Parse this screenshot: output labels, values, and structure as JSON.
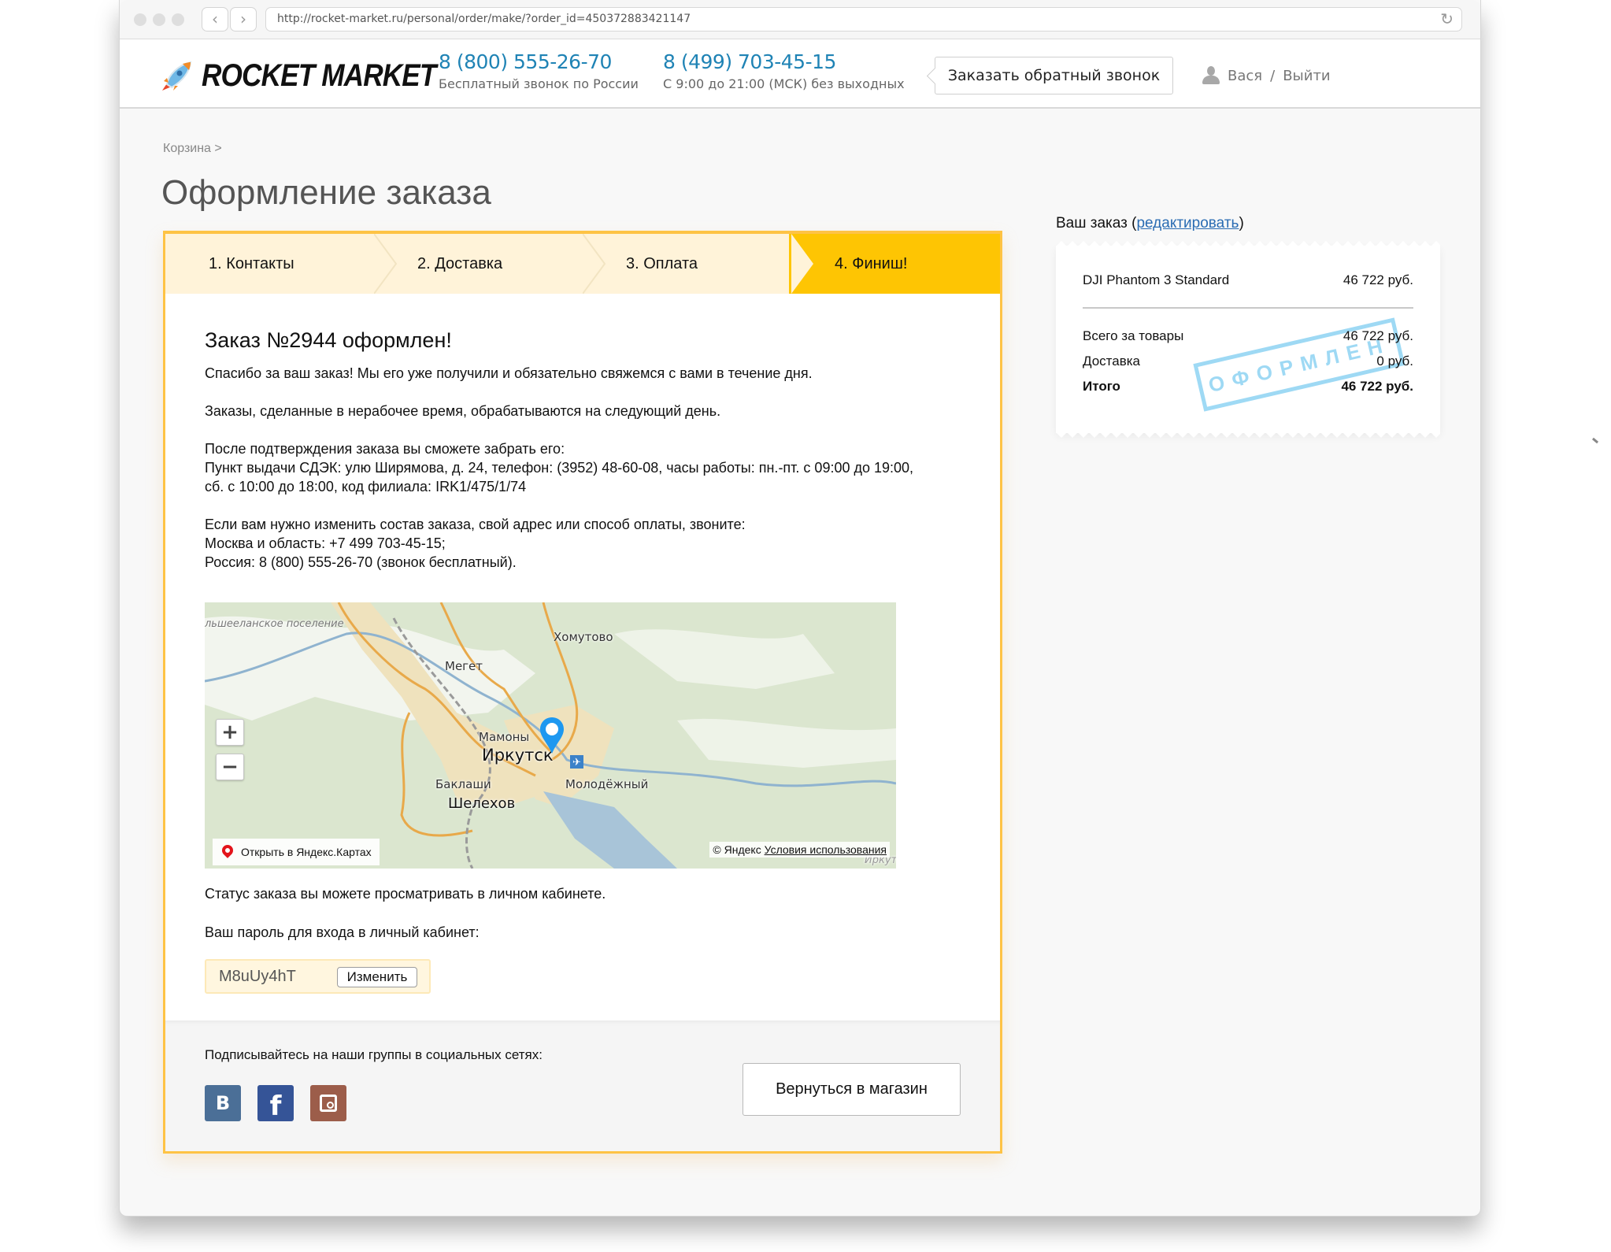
{
  "browser": {
    "url": "http://rocket-market.ru/personal/order/make/?order_id=450372883421147",
    "back_icon": "‹",
    "forward_icon": "›",
    "reload_icon": "↻"
  },
  "header": {
    "logo_text": "ROCKET MARKET",
    "phones": [
      {
        "number": "8 (800) 555-26-70",
        "caption": "Бесплатный звонок по России"
      },
      {
        "number": "8 (499) 703-45-15",
        "caption": "С 9:00 до 21:00 (МСК) без выходных"
      }
    ],
    "callback_label": "Заказать обратный звонок",
    "user_name": "Вася",
    "separator": "/",
    "logout_label": "Выйти"
  },
  "breadcrumb": "Корзина >",
  "page_title": "Оформление заказа",
  "steps": [
    {
      "label": "1. Контакты",
      "active": false
    },
    {
      "label": "2. Доставка",
      "active": false
    },
    {
      "label": "3. Оплата",
      "active": false
    },
    {
      "label": "4. Финиш!",
      "active": true
    }
  ],
  "order": {
    "title": "Заказ №2944 оформлен!",
    "thanks": "Спасибо за ваш заказ! Мы его уже получили и обязательно свяжемся с вами в течение дня.",
    "offhours": "Заказы, сделанные в нерабочее время, обрабатываются на следующий день.",
    "pickup_intro": "После подтверждения заказа вы сможете забрать его:",
    "pickup_line1": "Пункт выдачи СДЭК: улю Ширямова, д. 24, телефон: (3952) 48-60-08, часы работы: пн.-пт. с 09:00 до 19:00,",
    "pickup_line2": "сб. с 10:00 до 18:00, код филиала: IRK1/475/1/74",
    "change_intro": "Если вам нужно изменить состав заказа, свой адрес или способ оплаты, звоните:",
    "change_moscow": "Москва и область: +7 499 703-45-15;",
    "change_russia": "Россия: 8 (800) 555-26-70 (звонок бесплатный).",
    "status_text": "Статус заказа вы можете просматривать в личном кабинете.",
    "password_label": "Ваш пароль для входа в личный кабинет:",
    "password_value": "M8uUy4hT",
    "password_change_label": "Изменить"
  },
  "map": {
    "zoom_in": "+",
    "zoom_out": "−",
    "open_label": "Открыть в Яндекс.Картах",
    "copyright": "© Яндекс",
    "terms_link": "Условия использования",
    "labels": {
      "settlement": "льшееланское поселение",
      "khomutovo": "Хомутово",
      "meget": "Мегет",
      "mamony": "Мамоны",
      "irkutsk": "Иркутск",
      "baklashi": "Баклаши",
      "molodezhny": "Молодёжный",
      "shelekhov": "Шелехов",
      "irku_cut": "Иркут"
    }
  },
  "footer": {
    "social_label": "Подписывайтесь на наши группы в социальных сетях:",
    "social": [
      {
        "name": "vk",
        "glyph": "B",
        "color": "#4b6f97"
      },
      {
        "name": "facebook",
        "glyph": "f",
        "color": "#355497"
      },
      {
        "name": "instagram",
        "glyph": "",
        "color": "#9c5d4a"
      }
    ],
    "return_label": "Вернуться в магазин"
  },
  "sidebar": {
    "title": "Ваш заказ",
    "open_paren": " (",
    "edit_label": "редактировать",
    "close_paren": ")",
    "item_name": "DJI Phantom 3 Standard",
    "item_price": "46 722 руб.",
    "subtotal_label": "Всего за товары",
    "subtotal_value": "46 722 руб.",
    "delivery_label": "Доставка",
    "delivery_value": "0 руб.",
    "total_label": "Итого",
    "total_value": "46 722 руб.",
    "stamp_text": "ОФОРМЛЕН"
  },
  "colors": {
    "accent_yellow": "#fec503",
    "step_bg": "#fff3d9",
    "link_blue": "#1f83b5",
    "stamp_blue": "#8ed3f3"
  }
}
